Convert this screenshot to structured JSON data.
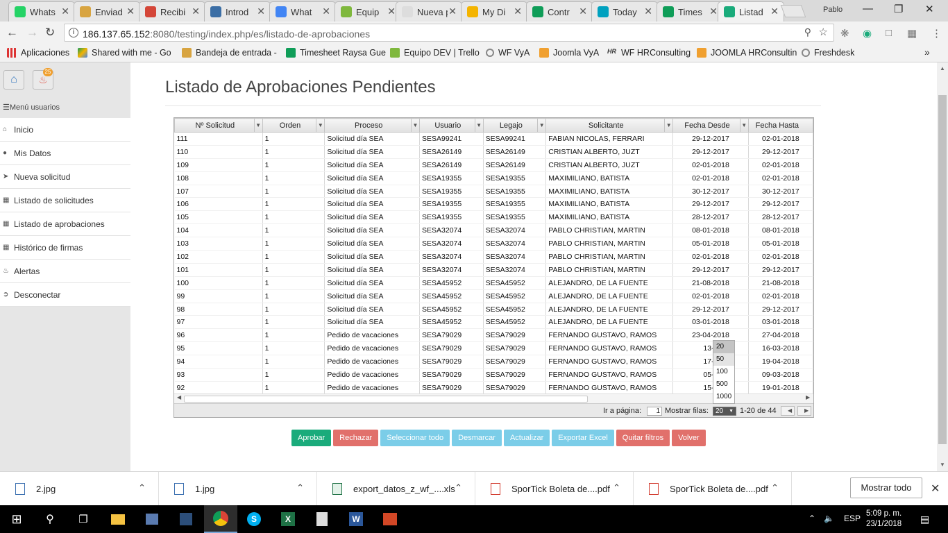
{
  "browser": {
    "tabs": [
      {
        "title": "Whats",
        "color": "#25d366"
      },
      {
        "title": "Enviad",
        "color": "#d8a440"
      },
      {
        "title": "Recibi",
        "color": "#d44638"
      },
      {
        "title": "Introd",
        "color": "#3b6ea5"
      },
      {
        "title": "What",
        "color": "#4285f4"
      },
      {
        "title": "Equip",
        "color": "#7fb83d"
      },
      {
        "title": "Nueva pe",
        "color": "#dddddd"
      },
      {
        "title": "My Di",
        "color": "#f4b400"
      },
      {
        "title": "Contr",
        "color": "#0f9d58"
      },
      {
        "title": "Today",
        "color": "#00a1bf"
      },
      {
        "title": "Times",
        "color": "#0f9d58"
      },
      {
        "title": "Listad",
        "color": "#1aab7b"
      }
    ],
    "profile_name": "Pablo",
    "url_host": "186.137.65.152",
    "url_path": ":8080/testing/index.php/es/listado-de-aprobaciones",
    "bookmarks": [
      "Aplicaciones",
      "Shared with me - Go",
      "Bandeja de entrada -",
      "Timesheet Raysa Gue",
      "Equipo DEV | Trello",
      "WF VyA",
      "Joomla VyA",
      "WF HRConsulting",
      "JOOMLA HRConsultin",
      "Freshdesk"
    ]
  },
  "sidebar": {
    "notification_count": "25",
    "menu_title": "Menú usuarios",
    "items": [
      {
        "label": "Inicio",
        "icon": "home-icon"
      },
      {
        "label": "Mis Datos",
        "icon": "user-icon"
      },
      {
        "label": "Nueva solicitud",
        "icon": "send-icon"
      },
      {
        "label": "Listado de solicitudes",
        "icon": "document-icon"
      },
      {
        "label": "Listado de aprobaciones",
        "icon": "document-icon"
      },
      {
        "label": "Histórico de firmas",
        "icon": "document-icon"
      },
      {
        "label": "Alertas",
        "icon": "bell-icon"
      },
      {
        "label": "Desconectar",
        "icon": "logout-icon"
      }
    ]
  },
  "main": {
    "title": "Listado de Aprobaciones Pendientes"
  },
  "grid": {
    "columns": [
      "Nº Solicitud",
      "Orden",
      "Proceso",
      "Usuario",
      "Legajo",
      "Solicitante",
      "Fecha Desde",
      "Fecha Hasta"
    ],
    "rows": [
      [
        "111",
        "1",
        "Solicitud día SEA",
        "SESA99241",
        "SESA99241",
        "FABIAN NICOLAS, FERRARI",
        "29-12-2017",
        "02-01-2018"
      ],
      [
        "110",
        "1",
        "Solicitud día SEA",
        "SESA26149",
        "SESA26149",
        "CRISTIAN ALBERTO, JUZT",
        "29-12-2017",
        "29-12-2017"
      ],
      [
        "109",
        "1",
        "Solicitud día SEA",
        "SESA26149",
        "SESA26149",
        "CRISTIAN ALBERTO, JUZT",
        "02-01-2018",
        "02-01-2018"
      ],
      [
        "108",
        "1",
        "Solicitud día SEA",
        "SESA19355",
        "SESA19355",
        "MAXIMILIANO, BATISTA",
        "02-01-2018",
        "02-01-2018"
      ],
      [
        "107",
        "1",
        "Solicitud día SEA",
        "SESA19355",
        "SESA19355",
        "MAXIMILIANO, BATISTA",
        "30-12-2017",
        "30-12-2017"
      ],
      [
        "106",
        "1",
        "Solicitud día SEA",
        "SESA19355",
        "SESA19355",
        "MAXIMILIANO, BATISTA",
        "29-12-2017",
        "29-12-2017"
      ],
      [
        "105",
        "1",
        "Solicitud día SEA",
        "SESA19355",
        "SESA19355",
        "MAXIMILIANO, BATISTA",
        "28-12-2017",
        "28-12-2017"
      ],
      [
        "104",
        "1",
        "Solicitud día SEA",
        "SESA32074",
        "SESA32074",
        "PABLO CHRISTIAN, MARTIN",
        "08-01-2018",
        "08-01-2018"
      ],
      [
        "103",
        "1",
        "Solicitud día SEA",
        "SESA32074",
        "SESA32074",
        "PABLO CHRISTIAN, MARTIN",
        "05-01-2018",
        "05-01-2018"
      ],
      [
        "102",
        "1",
        "Solicitud día SEA",
        "SESA32074",
        "SESA32074",
        "PABLO CHRISTIAN, MARTIN",
        "02-01-2018",
        "02-01-2018"
      ],
      [
        "101",
        "1",
        "Solicitud día SEA",
        "SESA32074",
        "SESA32074",
        "PABLO CHRISTIAN, MARTIN",
        "29-12-2017",
        "29-12-2017"
      ],
      [
        "100",
        "1",
        "Solicitud día SEA",
        "SESA45952",
        "SESA45952",
        "ALEJANDRO, DE LA FUENTE",
        "21-08-2018",
        "21-08-2018"
      ],
      [
        "99",
        "1",
        "Solicitud día SEA",
        "SESA45952",
        "SESA45952",
        "ALEJANDRO, DE LA FUENTE",
        "02-01-2018",
        "02-01-2018"
      ],
      [
        "98",
        "1",
        "Solicitud día SEA",
        "SESA45952",
        "SESA45952",
        "ALEJANDRO, DE LA FUENTE",
        "29-12-2017",
        "29-12-2017"
      ],
      [
        "97",
        "1",
        "Solicitud día SEA",
        "SESA45952",
        "SESA45952",
        "ALEJANDRO, DE LA FUENTE",
        "03-01-2018",
        "03-01-2018"
      ],
      [
        "96",
        "1",
        "Pedido de vacaciones",
        "SESA79029",
        "SESA79029",
        "FERNANDO GUSTAVO, RAMOS",
        "23-04-2018",
        "27-04-2018"
      ],
      [
        "95",
        "1",
        "Pedido de vacaciones",
        "SESA79029",
        "SESA79029",
        "FERNANDO GUSTAVO, RAMOS",
        "13-0",
        "16-03-2018"
      ],
      [
        "94",
        "1",
        "Pedido de vacaciones",
        "SESA79029",
        "SESA79029",
        "FERNANDO GUSTAVO, RAMOS",
        "17-0",
        "19-04-2018"
      ],
      [
        "93",
        "1",
        "Pedido de vacaciones",
        "SESA79029",
        "SESA79029",
        "FERNANDO GUSTAVO, RAMOS",
        "05-0",
        "09-03-2018"
      ],
      [
        "92",
        "1",
        "Pedido de vacaciones",
        "SESA79029",
        "SESA79029",
        "FERNANDO GUSTAVO, RAMOS",
        "15-0",
        "19-01-2018"
      ]
    ],
    "pager": {
      "goto_label": "Ir a página:",
      "page_value": "1",
      "rows_label": "Mostrar filas:",
      "rows_value": "20",
      "range_text": "1-20 de 44",
      "rows_options": [
        "20",
        "50",
        "100",
        "500",
        "1000"
      ]
    }
  },
  "actions": [
    {
      "label": "Aprobar",
      "style": "green"
    },
    {
      "label": "Rechazar",
      "style": "red"
    },
    {
      "label": "Seleccionar todo",
      "style": "blue"
    },
    {
      "label": "Desmarcar",
      "style": "blue"
    },
    {
      "label": "Actualizar",
      "style": "blue"
    },
    {
      "label": "Exportar Excel",
      "style": "blue"
    },
    {
      "label": "Quitar filtros",
      "style": "red"
    },
    {
      "label": "Volver",
      "style": "red"
    }
  ],
  "downloads": {
    "items": [
      {
        "name": "2.jpg",
        "type": "image"
      },
      {
        "name": "1.jpg",
        "type": "image"
      },
      {
        "name": "export_datos_z_wf_....xls",
        "type": "excel"
      },
      {
        "name": "SporTick Boleta de....pdf",
        "type": "pdf"
      },
      {
        "name": "SporTick Boleta de....pdf",
        "type": "pdf"
      }
    ],
    "show_all_label": "Mostrar todo"
  },
  "taskbar": {
    "language": "ESP",
    "time": "5:09 p. m.",
    "date": "23/1/2018"
  }
}
